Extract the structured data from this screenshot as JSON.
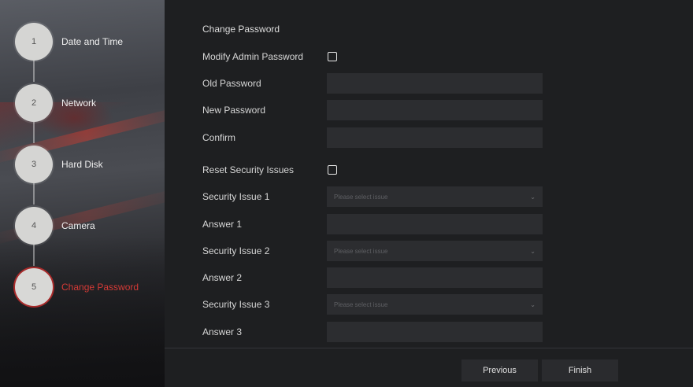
{
  "wizard": {
    "steps": [
      {
        "number": "1",
        "label": "Date and Time"
      },
      {
        "number": "2",
        "label": "Network"
      },
      {
        "number": "3",
        "label": "Hard Disk"
      },
      {
        "number": "4",
        "label": "Camera"
      },
      {
        "number": "5",
        "label": "Change Password"
      }
    ],
    "active_step": 5,
    "active_color": "#d43a36"
  },
  "form": {
    "title": "Change Password",
    "modify_admin_password_label": "Modify Admin Password",
    "modify_admin_password_checked": false,
    "old_password_label": "Old Password",
    "old_password_value": "",
    "new_password_label": "New Password",
    "new_password_value": "",
    "confirm_label": "Confirm",
    "confirm_value": "",
    "reset_security_label": "Reset Security Issues",
    "reset_security_checked": false,
    "security_issue_1_label": "Security Issue 1",
    "security_issue_1_placeholder": "Please select issue",
    "answer_1_label": "Answer 1",
    "answer_1_value": "",
    "security_issue_2_label": "Security Issue 2",
    "security_issue_2_placeholder": "Please select issue",
    "answer_2_label": "Answer 2",
    "answer_2_value": "",
    "security_issue_3_label": "Security Issue 3",
    "security_issue_3_placeholder": "Please select issue",
    "answer_3_label": "Answer 3",
    "answer_3_value": ""
  },
  "footer": {
    "previous_label": "Previous",
    "finish_label": "Finish"
  }
}
